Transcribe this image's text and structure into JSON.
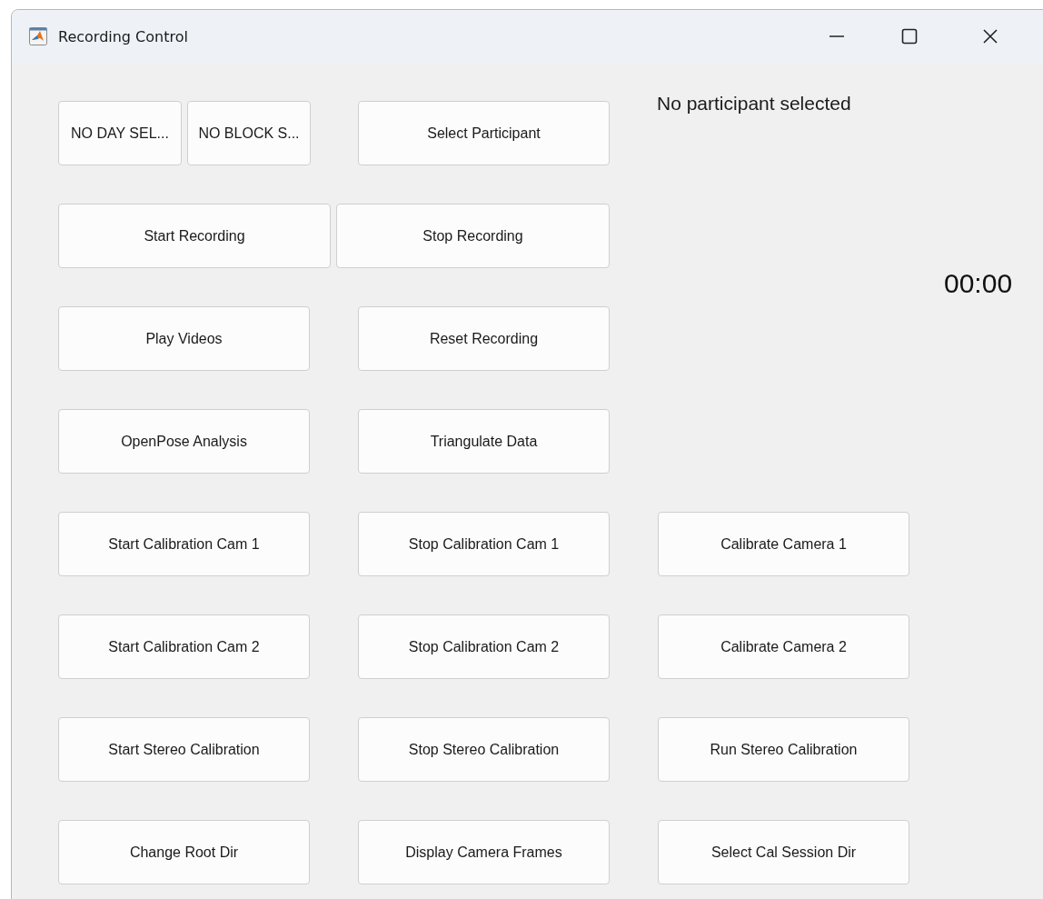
{
  "window": {
    "title": "Recording Control"
  },
  "status_text": "No participant selected",
  "timer": "00:00",
  "button_rows": [
    [
      "NO DAY SEL...",
      "NO BLOCK S...",
      "Select Participant"
    ],
    [
      "Start Recording",
      "Stop Recording"
    ],
    [
      "Play Videos",
      "Reset Recording"
    ],
    [
      "OpenPose Analysis",
      "Triangulate Data"
    ],
    [
      "Start Calibration Cam 1",
      "Stop Calibration Cam 1",
      "Calibrate Camera 1"
    ],
    [
      "Start Calibration Cam 2",
      "Stop Calibration Cam 2",
      "Calibrate Camera 2"
    ],
    [
      "Start Stereo Calibration",
      "Stop Stereo Calibration",
      "Run Stereo Calibration"
    ],
    [
      "Change Root Dir",
      "Display Camera Frames",
      "Select Cal Session Dir"
    ]
  ]
}
